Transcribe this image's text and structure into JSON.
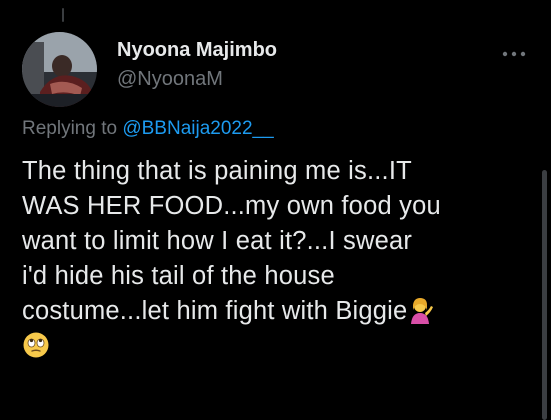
{
  "tweet": {
    "display_name": "Nyoona Majimbo",
    "handle": "@NyoonaM",
    "replying_prefix": "Replying to",
    "replying_mention": "@BBNaija2022__",
    "text_lines": [
      "The thing that is paining me is...IT",
      "WAS HER FOOD...my own food you",
      "want to limit how I eat it?...I swear",
      "i'd hide his tail of the house",
      "costume...let him fight with Biggie"
    ],
    "emojis": [
      "woman-tipping-hand",
      "face-with-rolling-eyes"
    ]
  },
  "icons": {
    "more": "more-horizontal-icon",
    "avatar": "profile-photo"
  },
  "colors": {
    "background": "#000000",
    "text_primary": "#e7e9ea",
    "text_secondary": "#71767b",
    "accent_blue": "#1d9bf0"
  }
}
